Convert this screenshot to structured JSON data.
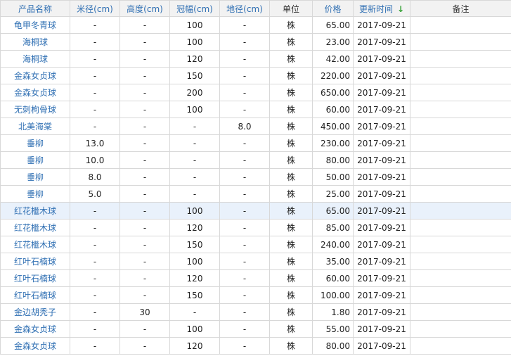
{
  "headers": {
    "name": "产品名称",
    "diameter": "米径(cm)",
    "height": "高度(cm)",
    "crown": "冠幅(cm)",
    "ground": "地径(cm)",
    "unit": "单位",
    "price": "价格",
    "updated": "更新时间",
    "note": "备注",
    "sort_icon": "↓"
  },
  "sort_icon_color": "#2e9e2e",
  "link_color": "#2f6fb3",
  "highlight_row_color": "#e9f1fb",
  "rows": [
    {
      "name": "龟甲冬青球",
      "diameter": "-",
      "height": "-",
      "crown": "100",
      "ground": "-",
      "unit": "株",
      "price": "65.00",
      "date": "2017-09-21",
      "note": ""
    },
    {
      "name": "海桐球",
      "diameter": "-",
      "height": "-",
      "crown": "100",
      "ground": "-",
      "unit": "株",
      "price": "23.00",
      "date": "2017-09-21",
      "note": ""
    },
    {
      "name": "海桐球",
      "diameter": "-",
      "height": "-",
      "crown": "120",
      "ground": "-",
      "unit": "株",
      "price": "42.00",
      "date": "2017-09-21",
      "note": ""
    },
    {
      "name": "金森女贞球",
      "diameter": "-",
      "height": "-",
      "crown": "150",
      "ground": "-",
      "unit": "株",
      "price": "220.00",
      "date": "2017-09-21",
      "note": ""
    },
    {
      "name": "金森女贞球",
      "diameter": "-",
      "height": "-",
      "crown": "200",
      "ground": "-",
      "unit": "株",
      "price": "650.00",
      "date": "2017-09-21",
      "note": ""
    },
    {
      "name": "无刺枸骨球",
      "diameter": "-",
      "height": "-",
      "crown": "100",
      "ground": "-",
      "unit": "株",
      "price": "60.00",
      "date": "2017-09-21",
      "note": ""
    },
    {
      "name": "北美海棠",
      "diameter": "-",
      "height": "-",
      "crown": "-",
      "ground": "8.0",
      "unit": "株",
      "price": "450.00",
      "date": "2017-09-21",
      "note": ""
    },
    {
      "name": "垂柳",
      "diameter": "13.0",
      "height": "-",
      "crown": "-",
      "ground": "-",
      "unit": "株",
      "price": "230.00",
      "date": "2017-09-21",
      "note": ""
    },
    {
      "name": "垂柳",
      "diameter": "10.0",
      "height": "-",
      "crown": "-",
      "ground": "-",
      "unit": "株",
      "price": "80.00",
      "date": "2017-09-21",
      "note": ""
    },
    {
      "name": "垂柳",
      "diameter": "8.0",
      "height": "-",
      "crown": "-",
      "ground": "-",
      "unit": "株",
      "price": "50.00",
      "date": "2017-09-21",
      "note": ""
    },
    {
      "name": "垂柳",
      "diameter": "5.0",
      "height": "-",
      "crown": "-",
      "ground": "-",
      "unit": "株",
      "price": "25.00",
      "date": "2017-09-21",
      "note": ""
    },
    {
      "name": "红花檵木球",
      "diameter": "-",
      "height": "-",
      "crown": "100",
      "ground": "-",
      "unit": "株",
      "price": "65.00",
      "date": "2017-09-21",
      "note": ""
    },
    {
      "name": "红花檵木球",
      "diameter": "-",
      "height": "-",
      "crown": "120",
      "ground": "-",
      "unit": "株",
      "price": "85.00",
      "date": "2017-09-21",
      "note": ""
    },
    {
      "name": "红花檵木球",
      "diameter": "-",
      "height": "-",
      "crown": "150",
      "ground": "-",
      "unit": "株",
      "price": "240.00",
      "date": "2017-09-21",
      "note": ""
    },
    {
      "name": "红叶石楠球",
      "diameter": "-",
      "height": "-",
      "crown": "100",
      "ground": "-",
      "unit": "株",
      "price": "35.00",
      "date": "2017-09-21",
      "note": ""
    },
    {
      "name": "红叶石楠球",
      "diameter": "-",
      "height": "-",
      "crown": "120",
      "ground": "-",
      "unit": "株",
      "price": "60.00",
      "date": "2017-09-21",
      "note": ""
    },
    {
      "name": "红叶石楠球",
      "diameter": "-",
      "height": "-",
      "crown": "150",
      "ground": "-",
      "unit": "株",
      "price": "100.00",
      "date": "2017-09-21",
      "note": ""
    },
    {
      "name": "金边胡秃子",
      "diameter": "-",
      "height": "30",
      "crown": "-",
      "ground": "-",
      "unit": "株",
      "price": "1.80",
      "date": "2017-09-21",
      "note": ""
    },
    {
      "name": "金森女贞球",
      "diameter": "-",
      "height": "-",
      "crown": "100",
      "ground": "-",
      "unit": "株",
      "price": "55.00",
      "date": "2017-09-21",
      "note": ""
    },
    {
      "name": "金森女贞球",
      "diameter": "-",
      "height": "-",
      "crown": "120",
      "ground": "-",
      "unit": "株",
      "price": "80.00",
      "date": "2017-09-21",
      "note": ""
    }
  ],
  "highlighted_row": 11
}
